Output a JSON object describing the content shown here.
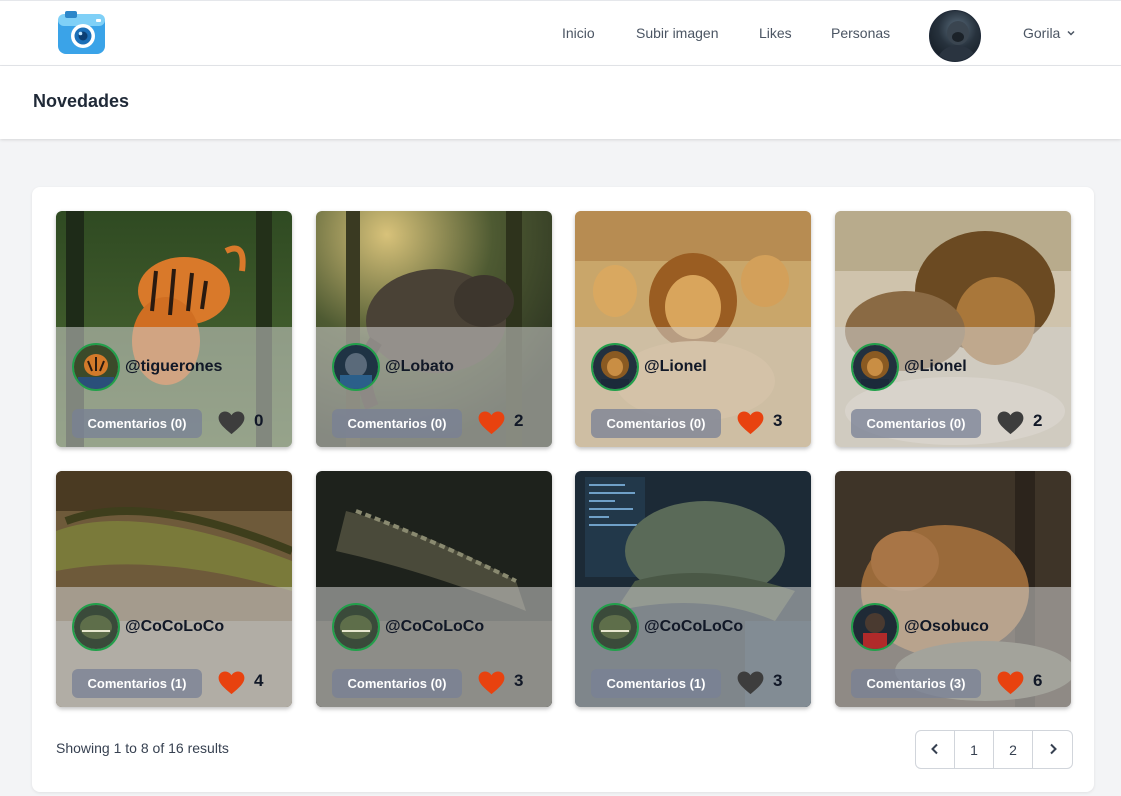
{
  "nav": {
    "links": [
      {
        "label": "Inicio"
      },
      {
        "label": "Subir imagen"
      },
      {
        "label": "Likes"
      },
      {
        "label": "Personas"
      }
    ],
    "user_name": "Gorila"
  },
  "header": {
    "title": "Novedades"
  },
  "colors": {
    "heart_liked": "#e8420f",
    "heart_unliked": "#3d3d3d",
    "avatar_ring": "#22a04b"
  },
  "posts": [
    {
      "user": "@tiguerones",
      "comments": "Comentarios (0)",
      "likes": "0",
      "liked": false,
      "subject": "tiger"
    },
    {
      "user": "@Lobato",
      "comments": "Comentarios (0)",
      "likes": "2",
      "liked": true,
      "subject": "wolf"
    },
    {
      "user": "@Lionel",
      "comments": "Comentarios (0)",
      "likes": "3",
      "liked": true,
      "subject": "lions"
    },
    {
      "user": "@Lionel",
      "comments": "Comentarios (0)",
      "likes": "2",
      "liked": false,
      "subject": "lion"
    },
    {
      "user": "@CoCoLoCo",
      "comments": "Comentarios (1)",
      "likes": "4",
      "liked": true,
      "subject": "crocodile"
    },
    {
      "user": "@CoCoLoCo",
      "comments": "Comentarios (0)",
      "likes": "3",
      "liked": true,
      "subject": "crocodile"
    },
    {
      "user": "@CoCoLoCo",
      "comments": "Comentarios (1)",
      "likes": "3",
      "liked": false,
      "subject": "crocodile"
    },
    {
      "user": "@Osobuco",
      "comments": "Comentarios (3)",
      "likes": "6",
      "liked": true,
      "subject": "bear"
    }
  ],
  "footer": {
    "results_prefix": "Showing",
    "from": "1",
    "to_word": "to",
    "to": "8",
    "of_word": "of",
    "total": "16",
    "results_suffix": "results",
    "pages": [
      "1",
      "2"
    ]
  }
}
